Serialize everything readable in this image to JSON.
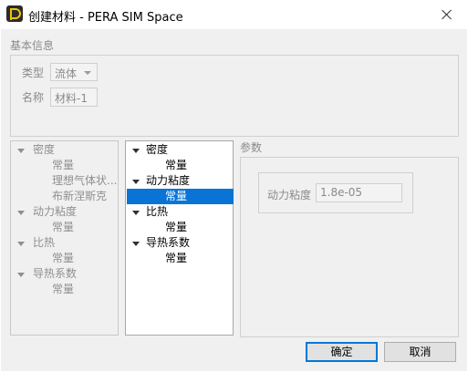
{
  "window": {
    "title": "创建材料 - PERA SIM Space"
  },
  "basic_info": {
    "section_label": "基本信息",
    "type_label": "类型",
    "type_value": "流体",
    "name_label": "名称",
    "name_value": "材料-1"
  },
  "left_tree": {
    "items": [
      {
        "label": "密度",
        "expandable": true
      },
      {
        "label": "常量"
      },
      {
        "label": "理想气体状..."
      },
      {
        "label": "布新涅斯克"
      },
      {
        "label": "动力粘度",
        "expandable": true
      },
      {
        "label": "常量"
      },
      {
        "label": "比热",
        "expandable": true
      },
      {
        "label": "常量"
      },
      {
        "label": "导热系数",
        "expandable": true
      },
      {
        "label": "常量"
      }
    ]
  },
  "middle_tree": {
    "items": [
      {
        "label": "密度",
        "expandable": true
      },
      {
        "label": "常量"
      },
      {
        "label": "动力粘度",
        "expandable": true
      },
      {
        "label": "常量",
        "selected": true
      },
      {
        "label": "比热",
        "expandable": true
      },
      {
        "label": "常量"
      },
      {
        "label": "导热系数",
        "expandable": true
      },
      {
        "label": "常量"
      }
    ]
  },
  "params": {
    "section_label": "参数",
    "viscosity_label": "动力粘度",
    "viscosity_value": "1.8e-05"
  },
  "buttons": {
    "ok": "确定",
    "cancel": "取消"
  }
}
